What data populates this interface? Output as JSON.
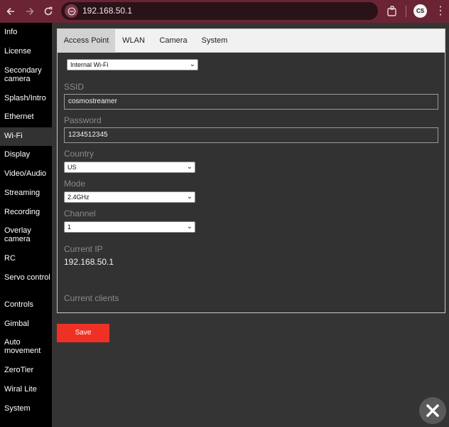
{
  "browser": {
    "url": "192.168.50.1",
    "profile_initials": "CS"
  },
  "sidebar": {
    "items": [
      {
        "label": "Info"
      },
      {
        "label": "License"
      },
      {
        "label": "Secondary camera"
      },
      {
        "label": "Splash/Intro"
      },
      {
        "label": "Ethernet"
      },
      {
        "label": "Wi-Fi",
        "active": true
      },
      {
        "label": "Display"
      },
      {
        "label": "Video/Audio"
      },
      {
        "label": "Streaming"
      },
      {
        "label": "Recording"
      },
      {
        "label": "Overlay camera"
      },
      {
        "label": "RC"
      },
      {
        "label": "Servo control"
      },
      {
        "label": "Controls"
      },
      {
        "label": "Gimbal"
      },
      {
        "label": "Auto movement"
      },
      {
        "label": "ZeroTier"
      },
      {
        "label": "Wiral Lite"
      },
      {
        "label": "System"
      }
    ]
  },
  "tabs": [
    {
      "label": "Access Point",
      "active": true
    },
    {
      "label": "WLAN"
    },
    {
      "label": "Camera"
    },
    {
      "label": "System"
    }
  ],
  "form": {
    "interface_select": "Internal Wi-Fi",
    "ssid_label": "SSID",
    "ssid_value": "cosmostreamer",
    "password_label": "Password",
    "password_value": "1234512345",
    "country_label": "Country",
    "country_value": "US",
    "mode_label": "Mode",
    "mode_value": "2.4GHz",
    "channel_label": "Channel",
    "channel_value": "1",
    "current_ip_label": "Current IP",
    "current_ip_value": "192.168.50.1",
    "current_clients_label": "Current clients"
  },
  "save_label": "Save",
  "colors": {
    "accent": "#ee3124",
    "chrome": "#6b2433",
    "sidebar_bg": "#000000",
    "content_bg": "#323232"
  }
}
